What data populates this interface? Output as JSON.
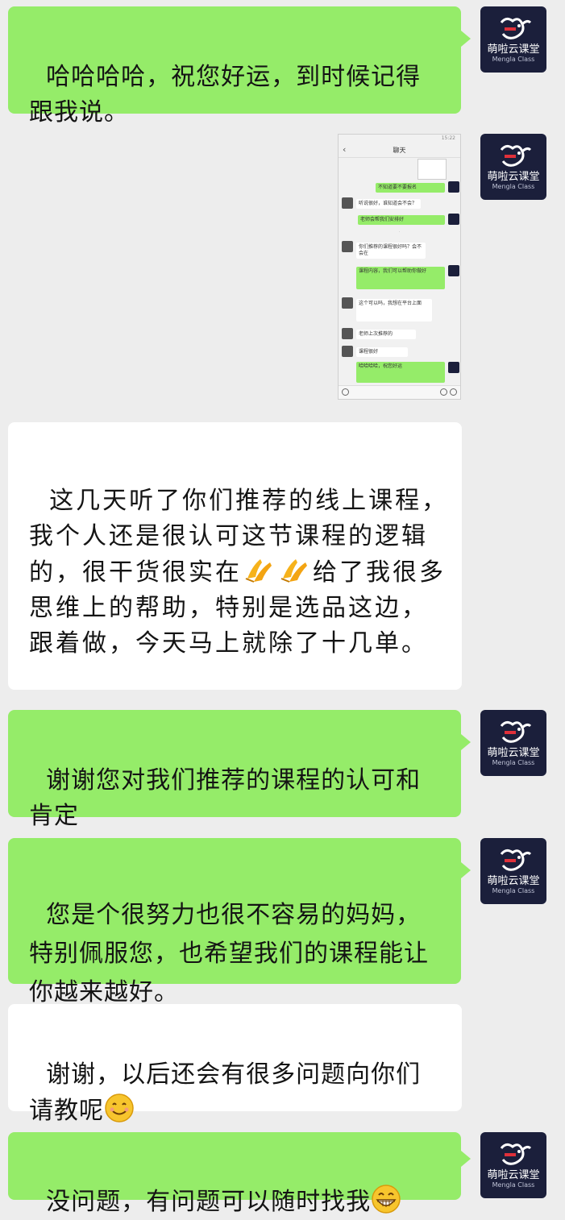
{
  "brand": {
    "avatar_name": "萌啦云课堂",
    "avatar_sub": "Mengla Class",
    "avatar_color": "#1b1f3b",
    "accent_red": "#e0303a"
  },
  "colors": {
    "background": "#ededed",
    "my_bubble": "#95ec69",
    "their_bubble": "#ffffff"
  },
  "messages": [
    {
      "side": "right",
      "type": "text",
      "text": "哈哈哈哈，祝您好运，到时候记得跟我说。"
    },
    {
      "side": "right",
      "type": "image",
      "image": {
        "title": "聊天",
        "status_time": "15:22",
        "bubbles": [
          {
            "side": "right",
            "text": "不知道要不要报名"
          },
          {
            "side": "left",
            "text": "听说很好，谁知道会不会？"
          },
          {
            "side": "right",
            "text": "老师会帮我们安排好"
          },
          {
            "side": "left",
            "text": "你们推荐的课程很好吗？会不会在"
          },
          {
            "side": "right",
            "text": "课程内容，我们可以帮助你做好"
          },
          {
            "side": "left",
            "text": "这个可以吗，我想在平台上面"
          },
          {
            "side": "left",
            "text": "老师上次推荐的"
          },
          {
            "side": "left",
            "text": "课程很好"
          },
          {
            "side": "right",
            "text": "哈哈哈哈，祝您好运"
          }
        ]
      }
    },
    {
      "side": "left",
      "type": "text",
      "text": "这几天听了你们推荐的线上课程，我个人还是很认可这节课程的逻辑的，很干货很实在",
      "emoji": "folded-hands-icon",
      "text_after": "给了我很多思维上的帮助，特别是选品这边，跟着做，今天马上就除了十几单。"
    },
    {
      "side": "right",
      "type": "text",
      "text": "谢谢您对我们推荐的课程的认可和肯定"
    },
    {
      "side": "right",
      "type": "text",
      "text": "您是个很努力也很不容易的妈妈，特别佩服您，也希望我们的课程能让你越来越好。"
    },
    {
      "side": "left",
      "type": "text",
      "text": "谢谢，以后还会有很多问题向你们请教呢",
      "emoji": "smiling-face-icon"
    },
    {
      "side": "right",
      "type": "text",
      "text": "没问题，有问题可以随时找我",
      "emoji": "grinning-face-icon"
    }
  ]
}
